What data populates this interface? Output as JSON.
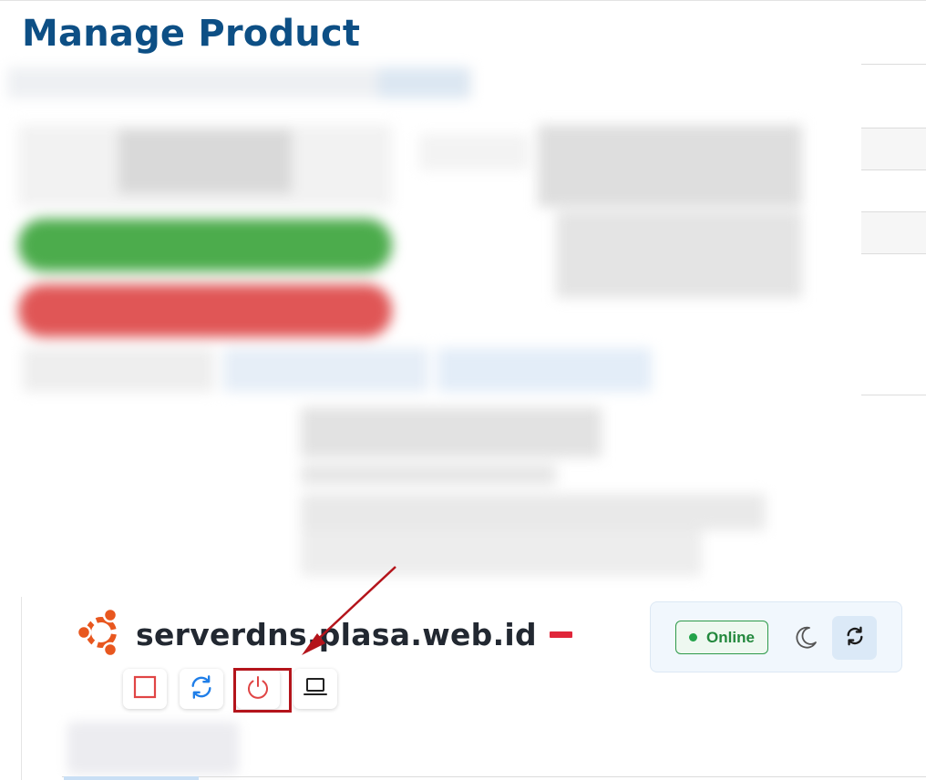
{
  "page": {
    "title": "Manage Product"
  },
  "server": {
    "hostname": "serverdns.plasa.web.id",
    "os_icon": "ubuntu-logo-icon",
    "flag_icon": "flag-icon",
    "status": "Online",
    "status_color": "#23883d",
    "theme_icon": "moon-icon",
    "refresh_icon": "refresh-icon"
  },
  "actions": [
    {
      "name": "stop-button",
      "icon": "stop-square-icon",
      "color": "#e04545"
    },
    {
      "name": "restart-button",
      "icon": "restart-icon",
      "color": "#1f7ee8"
    },
    {
      "name": "power-button",
      "icon": "power-icon",
      "color": "#e04545"
    },
    {
      "name": "console-button",
      "icon": "laptop-icon",
      "color": "#222222"
    }
  ],
  "annotation": {
    "highlight_color": "#b4141b"
  }
}
